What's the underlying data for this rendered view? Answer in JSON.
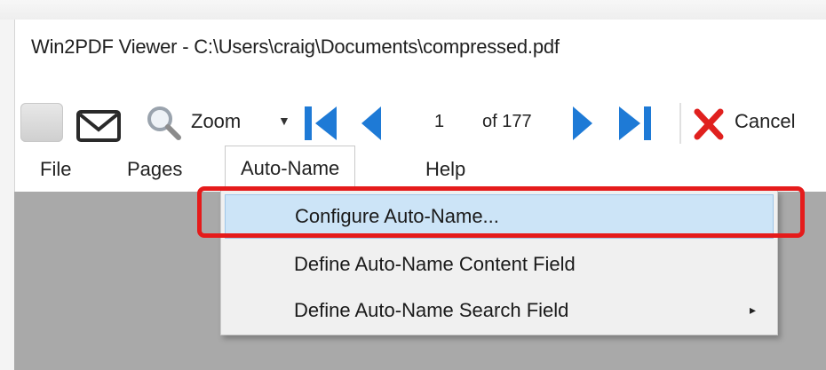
{
  "window": {
    "title": "Win2PDF Viewer - C:\\Users\\craig\\Documents\\compressed.pdf"
  },
  "toolbar": {
    "zoom_label": "Zoom",
    "page_current": "1",
    "page_of": "of 177",
    "cancel_label": "Cancel"
  },
  "menubar": {
    "items": [
      "File",
      "Pages",
      "Auto-Name",
      "Help"
    ]
  },
  "autoname_menu": {
    "items": [
      {
        "label": "Configure Auto-Name..."
      },
      {
        "label": "Define Auto-Name Content Field"
      },
      {
        "label": "Define Auto-Name Search Field",
        "submenu_arrow": "▸"
      }
    ]
  },
  "colors": {
    "nav_blue": "#1e7ad6",
    "cancel_red": "#e0201e",
    "highlight_red": "#e51b1b",
    "selected_bg": "#cce4f7"
  }
}
